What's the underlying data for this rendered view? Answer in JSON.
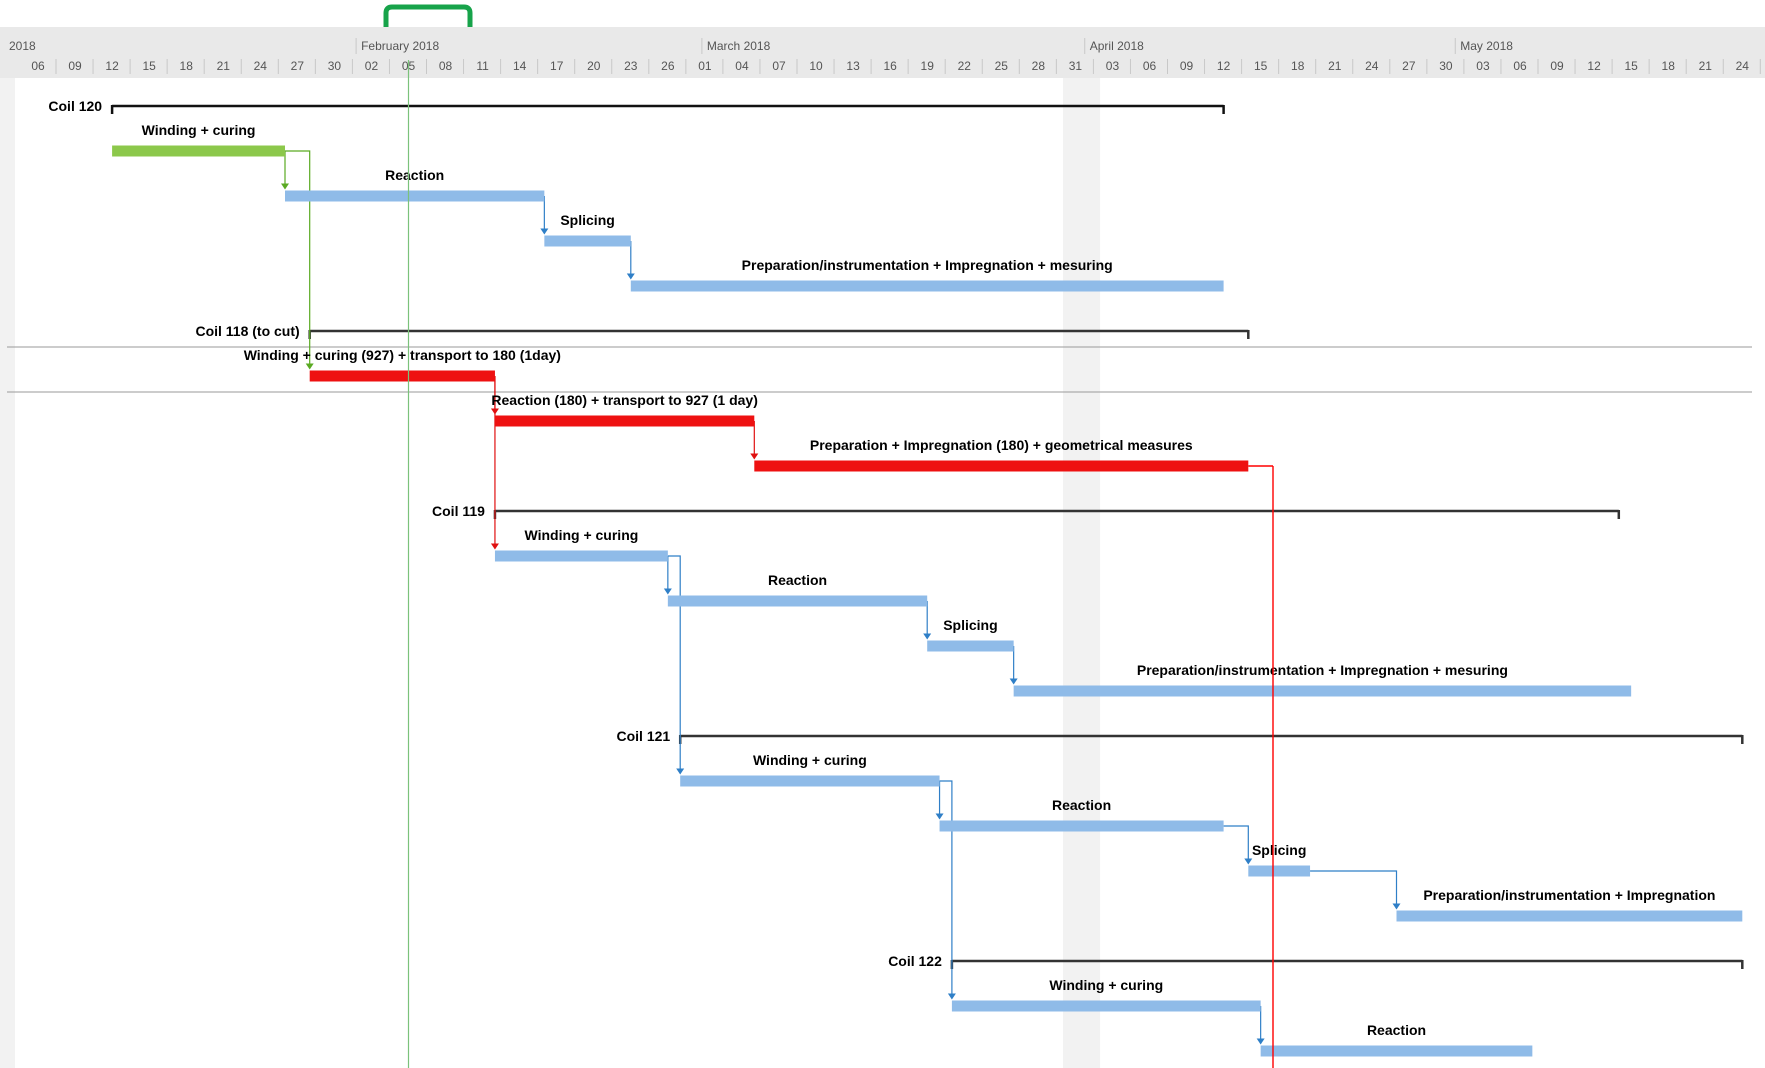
{
  "timeline": {
    "start_date": "2018-01-06",
    "end_date": "2018-05-24",
    "partial_year_label": "2018",
    "months": [
      {
        "label": "February 2018",
        "date": "2018-02-01"
      },
      {
        "label": "March 2018",
        "date": "2018-03-01"
      },
      {
        "label": "April 2018",
        "date": "2018-04-01"
      },
      {
        "label": "May 2018",
        "date": "2018-05-01"
      }
    ],
    "ticks": [
      {
        "date": "2018-01-06",
        "label": "06"
      },
      {
        "date": "2018-01-09",
        "label": "09"
      },
      {
        "date": "2018-01-12",
        "label": "12"
      },
      {
        "date": "2018-01-15",
        "label": "15"
      },
      {
        "date": "2018-01-18",
        "label": "18"
      },
      {
        "date": "2018-01-21",
        "label": "21"
      },
      {
        "date": "2018-01-24",
        "label": "24"
      },
      {
        "date": "2018-01-27",
        "label": "27"
      },
      {
        "date": "2018-01-30",
        "label": "30"
      },
      {
        "date": "2018-02-02",
        "label": "02"
      },
      {
        "date": "2018-02-05",
        "label": "05"
      },
      {
        "date": "2018-02-08",
        "label": "08"
      },
      {
        "date": "2018-02-11",
        "label": "11"
      },
      {
        "date": "2018-02-14",
        "label": "14"
      },
      {
        "date": "2018-02-17",
        "label": "17"
      },
      {
        "date": "2018-02-20",
        "label": "20"
      },
      {
        "date": "2018-02-23",
        "label": "23"
      },
      {
        "date": "2018-02-26",
        "label": "26"
      },
      {
        "date": "2018-03-01",
        "label": "01"
      },
      {
        "date": "2018-03-04",
        "label": "04"
      },
      {
        "date": "2018-03-07",
        "label": "07"
      },
      {
        "date": "2018-03-10",
        "label": "10"
      },
      {
        "date": "2018-03-13",
        "label": "13"
      },
      {
        "date": "2018-03-16",
        "label": "16"
      },
      {
        "date": "2018-03-19",
        "label": "19"
      },
      {
        "date": "2018-03-22",
        "label": "22"
      },
      {
        "date": "2018-03-25",
        "label": "25"
      },
      {
        "date": "2018-03-28",
        "label": "28"
      },
      {
        "date": "2018-03-31",
        "label": "31"
      },
      {
        "date": "2018-04-03",
        "label": "03"
      },
      {
        "date": "2018-04-06",
        "label": "06"
      },
      {
        "date": "2018-04-09",
        "label": "09"
      },
      {
        "date": "2018-04-12",
        "label": "12"
      },
      {
        "date": "2018-04-15",
        "label": "15"
      },
      {
        "date": "2018-04-18",
        "label": "18"
      },
      {
        "date": "2018-04-21",
        "label": "21"
      },
      {
        "date": "2018-04-24",
        "label": "24"
      },
      {
        "date": "2018-04-27",
        "label": "27"
      },
      {
        "date": "2018-04-30",
        "label": "30"
      },
      {
        "date": "2018-05-03",
        "label": "03"
      },
      {
        "date": "2018-05-06",
        "label": "06"
      },
      {
        "date": "2018-05-09",
        "label": "09"
      },
      {
        "date": "2018-05-12",
        "label": "12"
      },
      {
        "date": "2018-05-15",
        "label": "15"
      },
      {
        "date": "2018-05-18",
        "label": "18"
      },
      {
        "date": "2018-05-21",
        "label": "21"
      },
      {
        "date": "2018-05-24",
        "label": "24"
      }
    ],
    "today": "2018-02-05",
    "nonworking_band": {
      "start": "2018-03-30",
      "end": "2018-04-02"
    }
  },
  "colors": {
    "blue": "#8fbbe8",
    "blue_line": "#2f7fc7",
    "green": "#8cc84b",
    "green_line": "#5aaa22",
    "red": "#ee1111",
    "red_line": "#e01010",
    "group_line": "#333333",
    "today_line": "#7bc27b",
    "header_bg": "#e9e9e9",
    "scroll_handle": "#17a34a",
    "band": "#f2f2f2",
    "left_strip": "#f2f2f2",
    "separator": "#9a9a9a",
    "status_deadline": "#ff0000"
  },
  "red_deadline_line": {
    "date": "2018-04-16"
  },
  "groups": [
    {
      "id": "coil120",
      "label": "Coil 120",
      "start": "2018-01-12",
      "end": "2018-04-12"
    },
    {
      "id": "coil118",
      "label": "Coil 118 (to cut)",
      "start": "2018-01-28",
      "end": "2018-04-14"
    },
    {
      "id": "coil119",
      "label": "Coil 119",
      "start": "2018-02-12",
      "end": "2018-05-14"
    },
    {
      "id": "coil121",
      "label": "Coil 121",
      "start": "2018-02-27",
      "end": "2018-05-24"
    },
    {
      "id": "coil122",
      "label": "Coil 122",
      "start": "2018-03-21",
      "end": "2018-05-24"
    }
  ],
  "tasks": [
    {
      "id": "t1",
      "label": "Winding + curing",
      "start": "2018-01-12",
      "end": "2018-01-26",
      "color": "green",
      "row": 1
    },
    {
      "id": "t2",
      "label": "Reaction",
      "start": "2018-01-26",
      "end": "2018-02-16",
      "color": "blue",
      "row": 2
    },
    {
      "id": "t3",
      "label": "Splicing",
      "start": "2018-02-16",
      "end": "2018-02-23",
      "color": "blue",
      "row": 3
    },
    {
      "id": "t4",
      "label": "Preparation/instrumentation + Impregnation + mesuring",
      "start": "2018-02-23",
      "end": "2018-04-12",
      "color": "blue",
      "row": 4
    },
    {
      "id": "t5",
      "label": "Winding + curing (927) + transport to 180 (1day)",
      "start": "2018-01-28",
      "end": "2018-02-12",
      "color": "red",
      "row": 6
    },
    {
      "id": "t6",
      "label": "Reaction (180) + transport to 927 (1 day)",
      "start": "2018-02-12",
      "end": "2018-03-05",
      "color": "red",
      "row": 7
    },
    {
      "id": "t7",
      "label": "Preparation  + Impregnation (180) + geometrical measures",
      "start": "2018-03-05",
      "end": "2018-04-14",
      "color": "red",
      "row": 8
    },
    {
      "id": "t8",
      "label": "Winding + curing",
      "start": "2018-02-12",
      "end": "2018-02-26",
      "color": "blue",
      "row": 10
    },
    {
      "id": "t9",
      "label": "Reaction",
      "start": "2018-02-26",
      "end": "2018-03-19",
      "color": "blue",
      "row": 11
    },
    {
      "id": "t10",
      "label": "Splicing",
      "start": "2018-03-19",
      "end": "2018-03-26",
      "color": "blue",
      "row": 12
    },
    {
      "id": "t11",
      "label": "Preparation/instrumentation + Impregnation + mesuring",
      "start": "2018-03-26",
      "end": "2018-05-15",
      "color": "blue",
      "row": 13
    },
    {
      "id": "t12",
      "label": "Winding + curing",
      "start": "2018-02-27",
      "end": "2018-03-20",
      "color": "blue",
      "row": 15
    },
    {
      "id": "t13",
      "label": "Reaction",
      "start": "2018-03-20",
      "end": "2018-04-12",
      "color": "blue",
      "row": 16
    },
    {
      "id": "t14",
      "label": "Splicing",
      "start": "2018-04-14",
      "end": "2018-04-19",
      "color": "blue",
      "row": 17
    },
    {
      "id": "t15",
      "label": "Preparation/instrumentation + Impregnation",
      "start": "2018-04-26",
      "end": "2018-05-24",
      "color": "blue",
      "row": 18
    },
    {
      "id": "t16",
      "label": "Winding + curing",
      "start": "2018-03-21",
      "end": "2018-04-15",
      "color": "blue",
      "row": 20
    },
    {
      "id": "t17",
      "label": "Reaction",
      "start": "2018-04-15",
      "end": "2018-05-07",
      "color": "blue",
      "row": 21
    }
  ],
  "group_rows": {
    "coil120": 0,
    "coil118": 5,
    "coil119": 9,
    "coil121": 14,
    "coil122": 19
  },
  "links": [
    {
      "from": "t1",
      "to": "t2",
      "color": "green"
    },
    {
      "from": "t1",
      "to": "t5",
      "color": "green"
    },
    {
      "from": "t2",
      "to": "t3",
      "color": "blue"
    },
    {
      "from": "t3",
      "to": "t4",
      "color": "blue"
    },
    {
      "from": "t5",
      "to": "t6",
      "color": "red"
    },
    {
      "from": "t5",
      "to": "t8",
      "color": "red"
    },
    {
      "from": "t6",
      "to": "t7",
      "color": "red"
    },
    {
      "from": "t8",
      "to": "t9",
      "color": "blue"
    },
    {
      "from": "t8",
      "to": "t12",
      "color": "blue"
    },
    {
      "from": "t9",
      "to": "t10",
      "color": "blue"
    },
    {
      "from": "t10",
      "to": "t11",
      "color": "blue"
    },
    {
      "from": "t12",
      "to": "t13",
      "color": "blue"
    },
    {
      "from": "t12",
      "to": "t16",
      "color": "blue"
    },
    {
      "from": "t13",
      "to": "t14",
      "color": "blue"
    },
    {
      "from": "t14",
      "to": "t15",
      "color": "blue"
    },
    {
      "from": "t16",
      "to": "t17",
      "color": "blue"
    }
  ]
}
